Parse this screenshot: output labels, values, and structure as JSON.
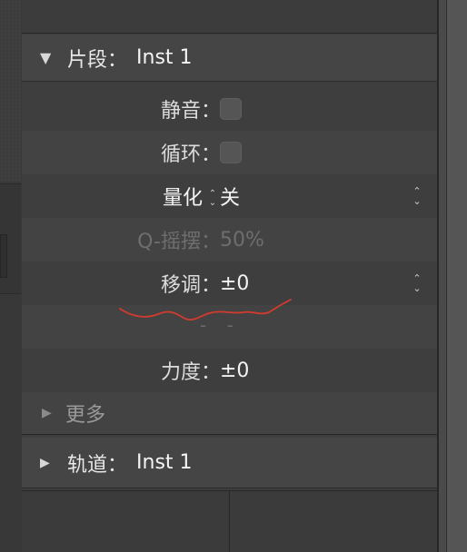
{
  "region": {
    "header_label": "片段：",
    "header_value": "Inst 1",
    "header_expanded_glyph": "▼"
  },
  "rows": {
    "mute": {
      "label": "静音：",
      "checked": false
    },
    "loop": {
      "label": "循环：",
      "checked": false
    },
    "quantize": {
      "label": "量化",
      "value": "关"
    },
    "q_swing": {
      "label": "Q-摇摆：",
      "value": "50%"
    },
    "transpose": {
      "label": "移调：",
      "value": "±0"
    },
    "velocity": {
      "label": "力度：",
      "value": "±0"
    }
  },
  "more": {
    "label": "更多",
    "glyph": "▶"
  },
  "track": {
    "header_label": "轨道：",
    "header_value": "Inst 1",
    "header_collapsed_glyph": "▶"
  },
  "dashes": "- -",
  "icons": {
    "stepper": "up-down-chevron-icon",
    "disclosure_open": "triangle-down-icon",
    "disclosure_closed": "triangle-right-icon"
  },
  "colors": {
    "panel_bg": "#3e3e3e",
    "header_bg": "#454545",
    "annotation": "#d33b2f",
    "dim_text": "#6e6e6e"
  }
}
